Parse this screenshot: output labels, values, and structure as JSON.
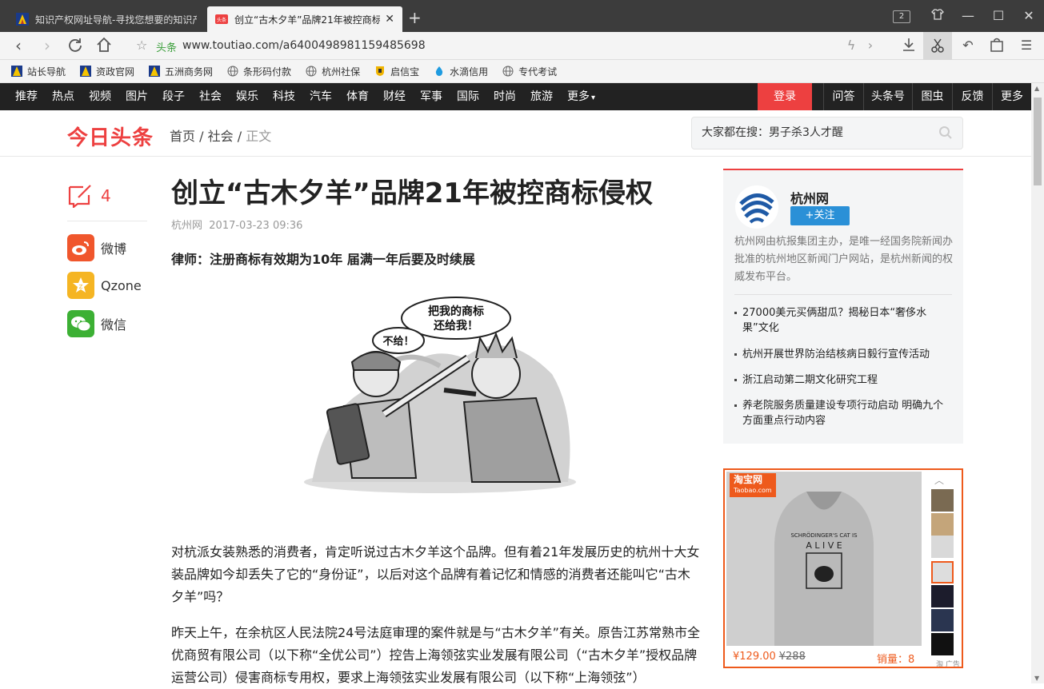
{
  "browser": {
    "tabs": [
      {
        "title": "知识产权网址导航-寻找您想要的知识产",
        "active": false
      },
      {
        "title": "创立“古木夕羊”品牌21年被控商标",
        "active": true
      }
    ],
    "window_count": "2",
    "url_tag": "头条",
    "url": "www.toutiao.com/a6400498981159485698"
  },
  "bookmarks": [
    {
      "label": "站长导航",
      "icon": "nav-a-icon"
    },
    {
      "label": "资政官网",
      "icon": "nav-a-icon"
    },
    {
      "label": "五洲商务网",
      "icon": "nav-a-icon"
    },
    {
      "label": "条形码付款",
      "icon": "globe-icon"
    },
    {
      "label": "杭州社保",
      "icon": "globe-icon"
    },
    {
      "label": "启信宝",
      "icon": "shield-icon"
    },
    {
      "label": "水滴信用",
      "icon": "drop-icon"
    },
    {
      "label": "专代考试",
      "icon": "globe-icon"
    }
  ],
  "sitenav": {
    "items": [
      "推荐",
      "热点",
      "视频",
      "图片",
      "段子",
      "社会",
      "娱乐",
      "科技",
      "汽车",
      "体育",
      "财经",
      "军事",
      "国际",
      "时尚",
      "旅游",
      "更多"
    ],
    "login": "登录",
    "right": [
      "问答",
      "头条号",
      "图虫",
      "反馈",
      "更多"
    ]
  },
  "header": {
    "logo": "今日头条",
    "crumb": {
      "home": "首页",
      "sep": "/",
      "cat": "社会",
      "current": "正文"
    },
    "search_text": "大家都在搜：男子杀3人才醒"
  },
  "share": {
    "comment_count": "4",
    "items": [
      {
        "label": "微博",
        "icon": "weibo-icon",
        "color": "#f0562c"
      },
      {
        "label": "Qzone",
        "icon": "qzone-icon",
        "color": "#f5b523"
      },
      {
        "label": "微信",
        "icon": "wechat-icon",
        "color": "#3cb034"
      }
    ]
  },
  "article": {
    "title": "创立“古木夕羊”品牌21年被控商标侵权",
    "source": "杭州网",
    "time": "2017-03-23 09:36",
    "subhead": "律师：注册商标有效期为10年 届满一年后要及时续展",
    "cartoon_bubble1": "把我的商标\n还给我！",
    "cartoon_bubble2": "不给！",
    "paragraphs": [
      "对杭派女装熟悉的消费者，肯定听说过古木夕羊这个品牌。但有着21年发展历史的杭州十大女装品牌如今却丢失了它的“身份证”，以后对这个品牌有着记忆和情感的消费者还能叫它“古木夕羊”吗？",
      "昨天上午，在余杭区人民法院24号法庭审理的案件就是与“古木夕羊”有关。原告江苏常熟市全优商贸有限公司（以下称“全优公司”）控告上海领弦实业发展有限公司（“古木夕羊”授权品牌运营公司）侵害商标专用权，要求上海领弦实业发展有限公司（以下称“上海领弦”）"
    ]
  },
  "publisher": {
    "name": "杭州网",
    "follow": "+关注",
    "desc": "杭州网由杭报集团主办，是唯一经国务院新闻办批准的杭州地区新闻门户网站，是杭州新闻的权威发布平台。",
    "links": [
      "27000美元买俩甜瓜？揭秘日本“奢侈水果”文化",
      "杭州开展世界防治结核病日毅行宣传活动",
      "浙江启动第二期文化研究工程",
      "养老院服务质量建设专项行动启动 明确九个方面重点行动内容"
    ]
  },
  "ad": {
    "brand": "淘宝网",
    "brand_sub": "Taobao.com",
    "shirt_text": "SCHRÖDINGER'S CAT IS\nA L I V E",
    "price": "¥129.00",
    "old_price": "¥288",
    "sales": "销量：8",
    "tag": "淘 广告",
    "accent": "#ee5a1c"
  },
  "colors": {
    "accent": "#ed4040",
    "nav_bg": "#222222",
    "follow": "#2a90d7"
  }
}
